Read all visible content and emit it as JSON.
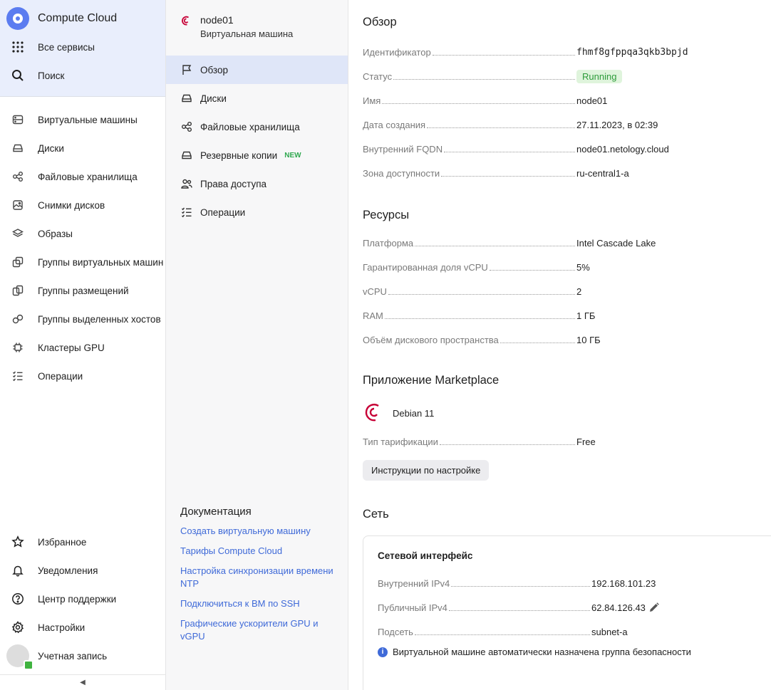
{
  "sidebar": {
    "brand": "Compute Cloud",
    "all_services": "Все сервисы",
    "search": "Поиск",
    "nav": [
      {
        "label": "Виртуальные машины",
        "icon": "server-icon"
      },
      {
        "label": "Диски",
        "icon": "disk-icon"
      },
      {
        "label": "Файловые хранилища",
        "icon": "share-icon"
      },
      {
        "label": "Снимки дисков",
        "icon": "image-icon"
      },
      {
        "label": "Образы",
        "icon": "layers-icon"
      },
      {
        "label": "Группы виртуальных машин",
        "icon": "cubes-icon"
      },
      {
        "label": "Группы размещений",
        "icon": "squares-icon"
      },
      {
        "label": "Группы выделенных хостов",
        "icon": "hosts-icon"
      },
      {
        "label": "Кластеры GPU",
        "icon": "chip-icon"
      },
      {
        "label": "Операции",
        "icon": "list-check-icon"
      }
    ],
    "bottom": [
      {
        "label": "Избранное",
        "icon": "star-icon"
      },
      {
        "label": "Уведомления",
        "icon": "bell-icon"
      },
      {
        "label": "Центр поддержки",
        "icon": "help-icon"
      },
      {
        "label": "Настройки",
        "icon": "gear-icon"
      }
    ],
    "account": "Учетная запись",
    "collapse": "◀"
  },
  "vm": {
    "name": "node01",
    "type": "Виртуальная машина"
  },
  "midnav": [
    {
      "label": "Обзор",
      "icon": "flag-icon",
      "active": true
    },
    {
      "label": "Диски",
      "icon": "disk-icon"
    },
    {
      "label": "Файловые хранилища",
      "icon": "share-icon"
    },
    {
      "label": "Резервные копии",
      "icon": "backup-icon",
      "badge": "NEW"
    },
    {
      "label": "Права доступа",
      "icon": "users-icon"
    },
    {
      "label": "Операции",
      "icon": "list-check-icon"
    }
  ],
  "docs": {
    "title": "Документация",
    "links": [
      "Создать виртуальную машину",
      "Тарифы Compute Cloud",
      "Настройка синхронизации времени NTP",
      "Подключиться к ВМ по SSH",
      "Графические ускорители GPU и vGPU"
    ]
  },
  "overview": {
    "title": "Обзор",
    "id_label": "Идентификатор",
    "id_value": "fhmf8gfppqa3qkb3bpjd",
    "status_label": "Статус",
    "status_value": "Running",
    "name_label": "Имя",
    "name_value": "node01",
    "created_label": "Дата создания",
    "created_value": "27.11.2023, в 02:39",
    "fqdn_label": "Внутренний FQDN",
    "fqdn_value": "node01.netology.cloud",
    "zone_label": "Зона доступности",
    "zone_value": "ru-central1-a"
  },
  "resources": {
    "title": "Ресурсы",
    "platform_label": "Платформа",
    "platform_value": "Intel Cascade Lake",
    "core_fraction_label": "Гарантированная доля vCPU",
    "core_fraction_value": "5%",
    "vcpu_label": "vCPU",
    "vcpu_value": "2",
    "ram_label": "RAM",
    "ram_value": "1 ГБ",
    "disk_label": "Объём дискового пространства",
    "disk_value": "10 ГБ"
  },
  "marketplace": {
    "title": "Приложение Marketplace",
    "product": "Debian 11",
    "billing_label": "Тип тарификации",
    "billing_value": "Free",
    "instructions_button": "Инструкции по настройке"
  },
  "network": {
    "title": "Сеть",
    "card_title": "Сетевой интерфейс",
    "internal_ip_label": "Внутренний IPv4",
    "internal_ip_value": "192.168.101.23",
    "public_ip_label": "Публичный IPv4",
    "public_ip_value": "62.84.126.43",
    "subnet_label": "Подсеть",
    "subnet_value": "subnet-a",
    "info_text": "Виртуальной машине автоматически назначена группа безопасности"
  },
  "colors": {
    "accent": "#3f6ad8",
    "active_bg": "#dfe6f8",
    "status_bg": "#dff4dc",
    "status_fg": "#2d9b3a",
    "new_badge": "#2fa84f"
  }
}
